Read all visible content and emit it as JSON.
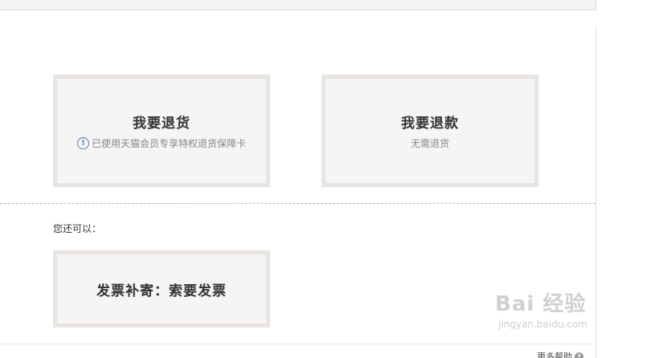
{
  "cards": {
    "return": {
      "title": "我要退货",
      "note": "已使用天猫会员专享特权退货保障卡"
    },
    "refund": {
      "title": "我要退款",
      "note": "无需退货"
    },
    "invoice": {
      "title": "发票补寄：索要发票"
    }
  },
  "also_label": "您还可以：",
  "help_link": "更多帮助",
  "watermark": {
    "logo": "Bai 经验",
    "url": "jingyan.baidu.com"
  },
  "colors": {
    "card_bg": "#f6f4f4",
    "card_border": "#e8e4df",
    "info_icon": "#4a7fc1"
  }
}
